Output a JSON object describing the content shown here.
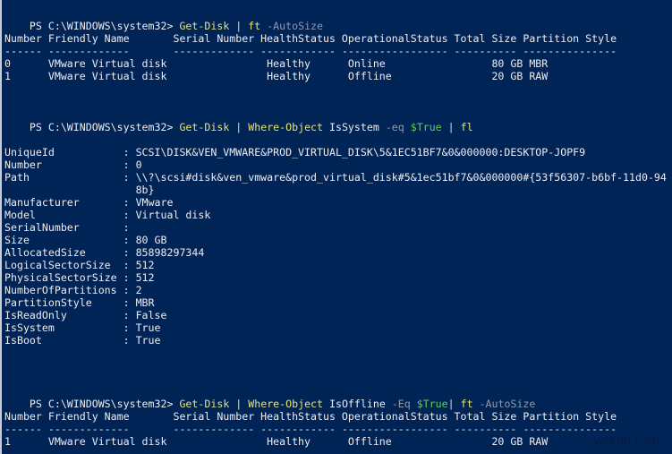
{
  "prompt": "PS C:\\WINDOWS\\system32> ",
  "commands": [
    {
      "parts": [
        {
          "t": "Get-Disk",
          "c": "cmd"
        },
        {
          "t": " | ",
          "c": "pipe"
        },
        {
          "t": "ft",
          "c": "cmd"
        },
        {
          "t": " -AutoSize",
          "c": "param"
        }
      ]
    },
    {
      "parts": [
        {
          "t": "Get-Disk",
          "c": "cmd"
        },
        {
          "t": " | ",
          "c": "pipe"
        },
        {
          "t": "Where-Object",
          "c": "cmd"
        },
        {
          "t": " IsSystem ",
          "c": "arg"
        },
        {
          "t": "-eq",
          "c": "param"
        },
        {
          "t": " ",
          "c": "arg"
        },
        {
          "t": "$True",
          "c": "var"
        },
        {
          "t": " | ",
          "c": "pipe"
        },
        {
          "t": "fl",
          "c": "cmd"
        }
      ]
    },
    {
      "parts": [
        {
          "t": "Get-Disk",
          "c": "cmd"
        },
        {
          "t": " | ",
          "c": "pipe"
        },
        {
          "t": "Where-Object",
          "c": "cmd"
        },
        {
          "t": " IsOffline ",
          "c": "arg"
        },
        {
          "t": "-Eq",
          "c": "param"
        },
        {
          "t": " ",
          "c": "arg"
        },
        {
          "t": "$True",
          "c": "var"
        },
        {
          "t": "| ",
          "c": "pipe"
        },
        {
          "t": "ft",
          "c": "cmd"
        },
        {
          "t": " -AutoSize",
          "c": "param"
        }
      ]
    }
  ],
  "table1": {
    "header": "Number Friendly Name       Serial Number HealthStatus OperationalStatus Total Size Partition Style",
    "separator": "------ -------------       ------------- ------------ ----------------- ---------- ---------------",
    "rows": [
      "0      VMware Virtual disk                Healthy      Online                 80 GB MBR",
      "1      VMware Virtual disk                Healthy      Offline                20 GB RAW"
    ]
  },
  "properties": [
    "UniqueId           : SCSI\\DISK&VEN_VMWARE&PROD_VIRTUAL_DISK\\5&1EC51BF7&0&000000:DESKTOP-JOPF9",
    "Number             : 0",
    "Path               : \\\\?\\scsi#disk&ven_vmware&prod_virtual_disk#5&1ec51bf7&0&000000#{53f56307-b6bf-11d0-94",
    "                     8b}",
    "Manufacturer       : VMware",
    "Model              : Virtual disk",
    "SerialNumber       :",
    "Size               : 80 GB",
    "AllocatedSize      : 85898297344",
    "LogicalSectorSize  : 512",
    "PhysicalSectorSize : 512",
    "NumberOfPartitions : 2",
    "PartitionStyle     : MBR",
    "IsReadOnly         : False",
    "IsSystem           : True",
    "IsBoot             : True"
  ],
  "table2": {
    "header": "Number Friendly Name       Serial Number HealthStatus OperationalStatus Total Size Partition Style",
    "separator": "------ -------------       ------------- ------------ ----------------- ---------- ---------------",
    "rows": [
      "1      VMware Virtual disk                Healthy      Offline                20 GB RAW"
    ]
  },
  "watermark": "wsxdn.com"
}
